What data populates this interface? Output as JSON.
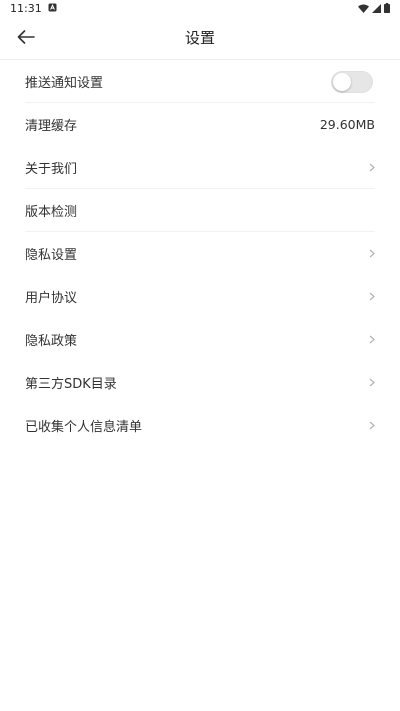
{
  "status_bar": {
    "time": "11:31",
    "notification_icon": "a-box-icon",
    "wifi_icon": "wifi-icon",
    "signal_icon": "cellular-signal-icon",
    "battery_icon": "battery-icon"
  },
  "header": {
    "title": "设置",
    "back_icon": "arrow-left-icon"
  },
  "settings": {
    "push": {
      "label": "推送通知设置",
      "toggle_on": false
    },
    "cache": {
      "label": "清理缓存",
      "value": "29.60MB"
    },
    "about": {
      "label": "关于我们"
    },
    "version": {
      "label": "版本检测"
    },
    "privacy_settings": {
      "label": "隐私设置"
    },
    "user_agreement": {
      "label": "用户协议"
    },
    "privacy_policy": {
      "label": "隐私政策"
    },
    "third_party_sdk": {
      "label": "第三方SDK目录"
    },
    "collected_info": {
      "label": "已收集个人信息清单"
    }
  },
  "colors": {
    "text": "#333333",
    "chevron": "#b3b3b3",
    "toggle_off": "#e6e6e6",
    "divider": "#f1f1f1"
  }
}
